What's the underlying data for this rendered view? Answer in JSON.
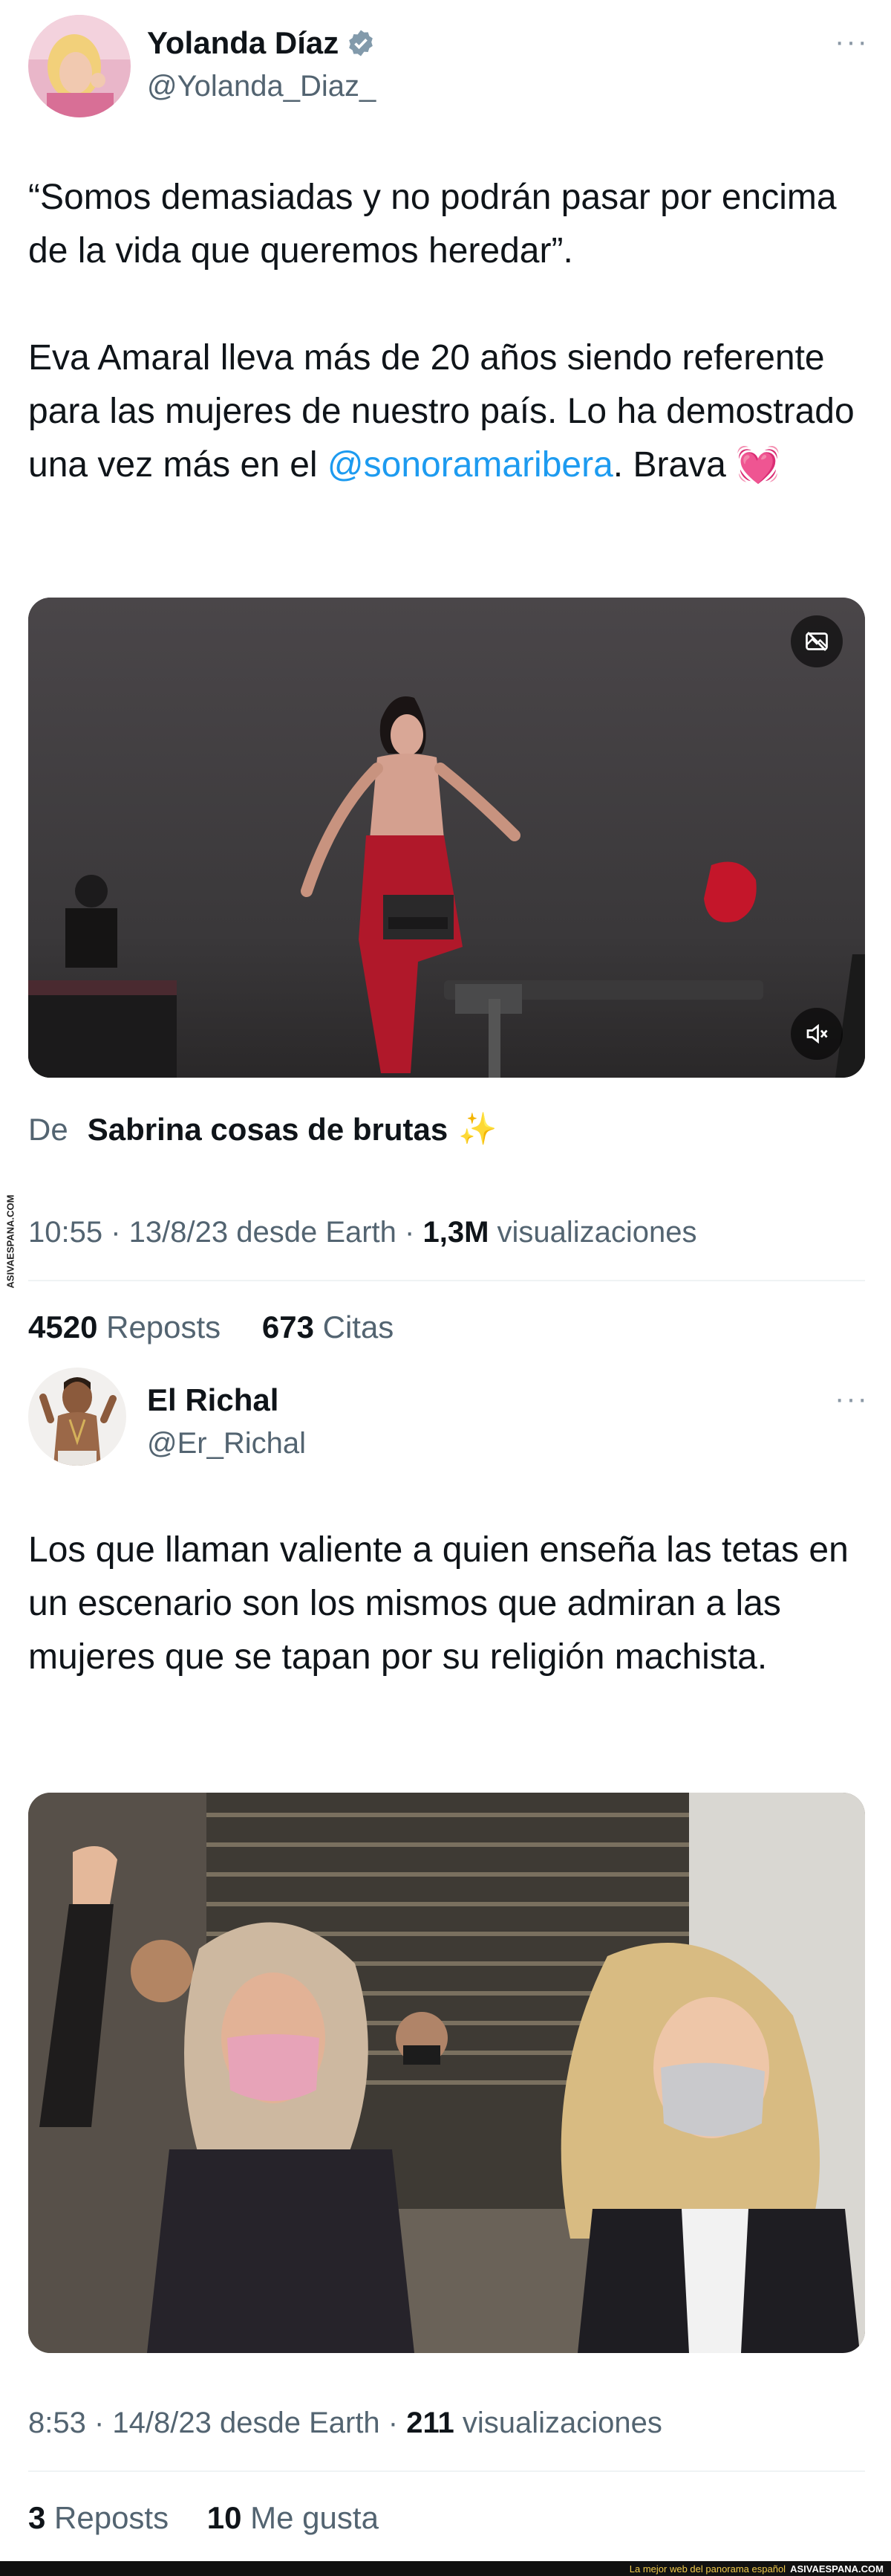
{
  "colors": {
    "accent": "#1d9bf0",
    "text": "#0f1419",
    "muted": "#536471",
    "heart": "#e0245e"
  },
  "tweet1": {
    "name": "Yolanda Díaz",
    "handle": "@Yolanda_Diaz_",
    "more": "···",
    "line1": "“Somos demasiadas y no podrán pasar por encima de la vida que queremos heredar”.",
    "line2_pre": "Eva Amaral lleva más de 20 años siendo referente para las mujeres de nuestro país. Lo ha demostrado una vez más en el ",
    "mention": "@sonoramaribera",
    "line2_post": ". Brava ",
    "emoji": "💓",
    "from_label": "De",
    "from_source": "Sabrina cosas de brutas",
    "from_emoji": "✨",
    "time": "10:55 · 13/8/23 desde Earth · ",
    "views_count": "1,3M",
    "views_label": " visualizaciones",
    "reposts_count": "4520",
    "reposts_label": " Reposts",
    "quotes_count": "673",
    "quotes_label": " Citas"
  },
  "tweet2": {
    "name": "El Richal",
    "handle": "@Er_Richal",
    "more": "···",
    "text": "Los que llaman valiente a quien enseña las tetas en un escenario son los mismos que admiran a las mujeres que se tapan por su religión machista.",
    "time": "8:53 · 14/8/23 desde Earth · ",
    "views_count": "211",
    "views_label": " visualizaciones",
    "reposts_count": "3",
    "reposts_label": " Reposts",
    "likes_count": "10",
    "likes_label": " Me gusta"
  },
  "watermark": {
    "side": "ASIVAESPANA.COM",
    "footer_text": "La mejor web del panorama español",
    "footer_brand": "ASIVAESPANA.COM"
  }
}
